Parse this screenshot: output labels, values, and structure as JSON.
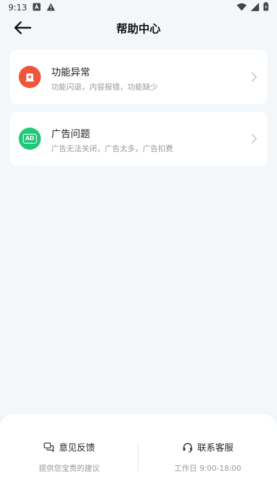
{
  "status_bar": {
    "time": "9:13"
  },
  "header": {
    "title": "帮助中心"
  },
  "cards": [
    {
      "title": "功能异常",
      "desc": "功能闪退，内容报错，功能缺少",
      "badge_color": "#f0543a",
      "badge_text": ""
    },
    {
      "title": "广告问题",
      "desc": "广告无法关闭，广告太多，广告扣费",
      "badge_color": "#1fc97a",
      "badge_text": "AD"
    }
  ],
  "bottom": {
    "feedback": {
      "title": "意见反馈",
      "subtitle": "提供您宝贵的建议"
    },
    "service": {
      "title": "联系客服",
      "subtitle": "工作日 9:00-18:00"
    }
  }
}
